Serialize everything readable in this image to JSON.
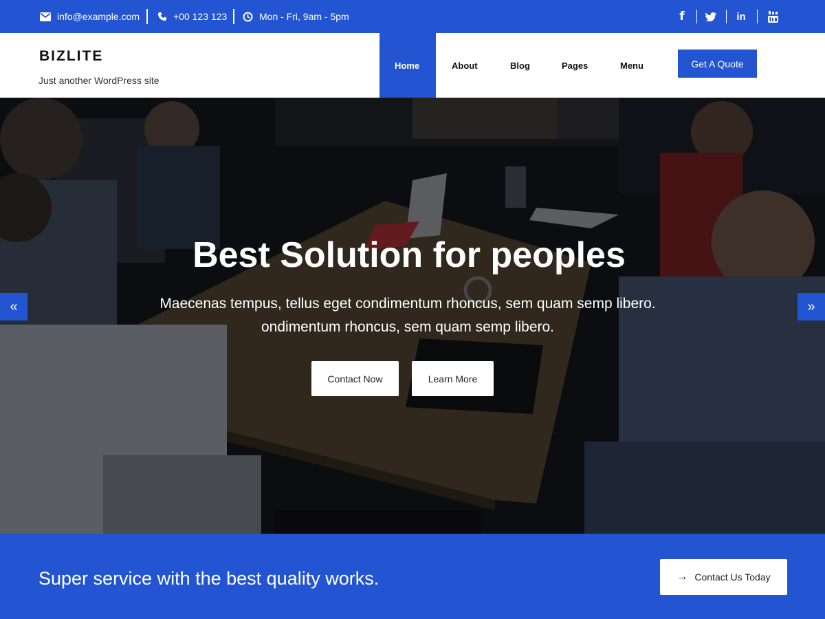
{
  "topbar": {
    "email": "info@example.com",
    "phone": "+00 123 123",
    "hours": "Mon - Fri, 9am - 5pm",
    "social": [
      "facebook-icon",
      "twitter-icon",
      "linkedin-icon",
      "youtube-icon"
    ],
    "social_glyphs": {
      "facebook": "f",
      "twitter": "t",
      "linkedin": "in"
    }
  },
  "header": {
    "logo": "BIZLITE",
    "tagline": "Just another WordPress site",
    "nav": [
      "Home",
      "About",
      "Blog",
      "Pages",
      "Menu"
    ],
    "active_nav": "Home",
    "quote_label": "Get A Quote"
  },
  "hero": {
    "title": "Best Solution for peoples",
    "subtitle_line1": "Maecenas tempus, tellus eget condimentum rhoncus, sem quam semp libero.",
    "subtitle_line2": "ondimentum rhoncus, sem quam semp libero.",
    "button_primary": "Contact Now",
    "button_secondary": "Learn More",
    "prev_arrow": "«",
    "next_arrow": "»"
  },
  "cta": {
    "text": "Super service with the best quality works.",
    "button_label": "Contact Us Today",
    "button_icon": "arrow-right-icon",
    "button_glyph": "→"
  },
  "colors": {
    "accent": "#2354d1",
    "text_dark": "#111111",
    "white": "#ffffff"
  }
}
